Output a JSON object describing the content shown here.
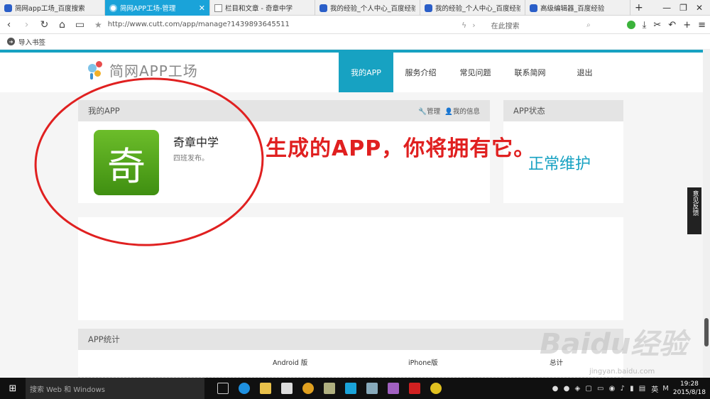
{
  "browser": {
    "tabs": [
      {
        "title": "简网app工场_百度搜索",
        "active": false,
        "icon": "paw-icon"
      },
      {
        "title": "简网APP工场-管理",
        "active": true,
        "icon": "app-icon"
      },
      {
        "title": "栏目和文章 - 奇章中学",
        "active": false,
        "icon": "page-icon"
      },
      {
        "title": "我的经验_个人中心_百度经验",
        "active": false,
        "icon": "paw-icon"
      },
      {
        "title": "我的经验_个人中心_百度经验",
        "active": false,
        "icon": "paw-icon"
      },
      {
        "title": "高级编辑器_百度经验",
        "active": false,
        "icon": "paw-icon"
      }
    ],
    "new_tab": "+",
    "url": "http://www.cutt.com/app/manage?1439893645511",
    "search_placeholder": "在此搜索",
    "bookmark_import": "导入书签"
  },
  "site": {
    "logo_text": "简网APP工场",
    "nav": [
      {
        "label": "我的APP",
        "active": true
      },
      {
        "label": "服务介绍",
        "active": false
      },
      {
        "label": "常见问题",
        "active": false
      },
      {
        "label": "联系简网",
        "active": false
      },
      {
        "label": "退出",
        "active": false
      }
    ],
    "my_app": {
      "header": "我的APP",
      "manage": "管理",
      "my_info": "我的信息",
      "icon_char": "奇",
      "name": "奇章中学",
      "desc": "四班发布。"
    },
    "app_status": {
      "header": "APP状态",
      "value": "正常维护"
    },
    "stats": {
      "header": "APP统计",
      "cols": [
        "Android 版",
        "iPhone版",
        "总计"
      ]
    },
    "feedback": "意见反馈"
  },
  "annotation": "生成的APP，你将拥有它。",
  "watermark": {
    "main": "Baidu经验",
    "sub": "jingyan.baidu.com"
  },
  "taskbar": {
    "search": "搜索 Web 和 Windows",
    "time": "19:28",
    "date": "2015/8/18",
    "ime": "英"
  },
  "colors": {
    "accent": "#17a2c2",
    "annotation": "#e02020",
    "app_icon": "#4fa21a"
  }
}
